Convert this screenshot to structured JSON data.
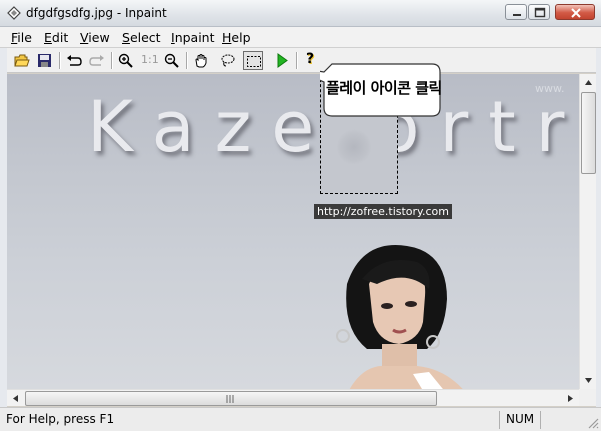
{
  "window": {
    "title": "dfgdfgsdfg.jpg - Inpaint",
    "min_icon": "minimize-icon",
    "max_icon": "maximize-icon",
    "close_icon": "close-icon"
  },
  "menu": [
    {
      "key": "file",
      "first": "F",
      "rest": "ile"
    },
    {
      "key": "edit",
      "first": "E",
      "rest": "dit"
    },
    {
      "key": "view",
      "first": "V",
      "rest": "iew"
    },
    {
      "key": "select",
      "first": "S",
      "rest": "elect"
    },
    {
      "key": "inpaint",
      "first": "I",
      "rest": "npaint"
    },
    {
      "key": "help",
      "first": "H",
      "rest": "elp"
    }
  ],
  "toolbar": {
    "icons": [
      "open-folder-icon",
      "save-icon",
      "undo-icon",
      "redo-icon",
      "zoom-in-icon",
      "actual-size-icon",
      "zoom-out-icon",
      "hand-pan-icon",
      "lasso-icon",
      "rect-select-icon",
      "play-icon",
      "help-icon"
    ],
    "actual_size_label": "1:1",
    "help_label": "?"
  },
  "canvas": {
    "photo_text": "Kaze ortra",
    "photo_www": "www.",
    "url_tag": "http://zofree.tistory.com",
    "callout": "플레이 아이콘 클릭"
  },
  "statusbar": {
    "text": "For Help, press F1",
    "num": "NUM"
  },
  "colors": {
    "play": "#22b422",
    "title_bar": "#dfe3e8",
    "canvas_bg": "#c3c7cf"
  }
}
